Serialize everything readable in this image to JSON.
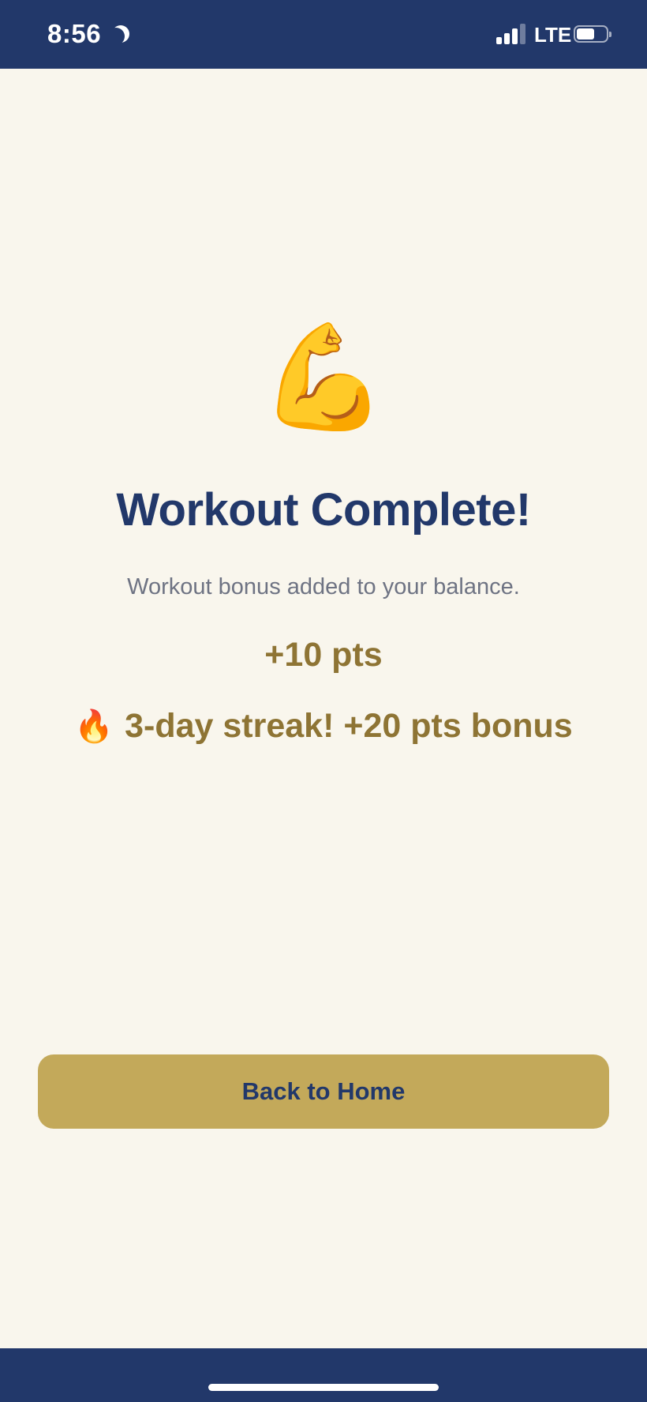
{
  "status_bar": {
    "time": "8:56",
    "network": "LTE",
    "icons": [
      "moon-icon",
      "signal-icon",
      "battery-icon"
    ]
  },
  "main": {
    "hero_emoji": "💪",
    "title": "Workout Complete!",
    "subtitle": "Workout bonus added to your balance.",
    "points": "+10 pts",
    "streak_emoji": "🔥",
    "streak_text": "3-day streak! +20 pts bonus"
  },
  "actions": {
    "home_button_label": "Back to Home"
  },
  "colors": {
    "background": "#f9f6ed",
    "navy": "#22386a",
    "gold": "#c3a95a",
    "gold_text": "#8e7434",
    "muted_text": "#6e7383"
  }
}
